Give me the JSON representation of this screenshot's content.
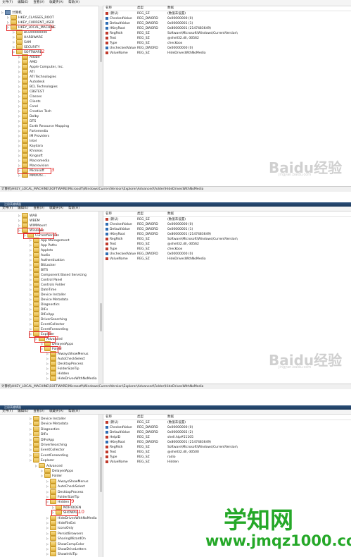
{
  "menu": [
    "文件(F)",
    "编辑(E)",
    "查看(V)",
    "收藏夹(A)",
    "帮助(H)"
  ],
  "window_title": "注册表编辑器",
  "list_headers": {
    "name": "名称",
    "type": "类型",
    "data": "数据"
  },
  "panel1": {
    "tree": [
      "计算机",
      "HKEY_CLASSES_ROOT",
      "HKEY_CURRENT_USER",
      "HKEY_LOCAL_MACHINE",
      "BCD00000000",
      "HARDWARE",
      "SAM",
      "SECURITY",
      "SOFTWARE",
      "Adobe",
      "AMD",
      "Apple Computer, Inc.",
      "ATI",
      "ATI Technologies",
      "Autodesk",
      "BCL Technologies",
      "CBSTEST",
      "Classes",
      "Clients",
      "Corel",
      "Creative Tech",
      "Dolby",
      "DTS",
      "Earth Resource Mapping",
      "Fortemedia",
      "IM Providers",
      "Intel",
      "Kaydara",
      "Khronos",
      "Kingsoft",
      "Macromedia",
      "Macrovision",
      "Microsoft",
      "MMXUtx..."
    ],
    "markers": [
      "1",
      "2",
      "3"
    ],
    "values": [
      {
        "name": "(默认)",
        "type": "REG_SZ",
        "data": "(数值未设置)",
        "icon": "sz"
      },
      {
        "name": "CheckedValue",
        "type": "REG_DWORD",
        "data": "0x00000000 (0)",
        "icon": "dw"
      },
      {
        "name": "DefaultValue",
        "type": "REG_DWORD",
        "data": "0x00000001 (1)",
        "icon": "dw"
      },
      {
        "name": "HKeyRoot",
        "type": "REG_DWORD",
        "data": "0x80000001 (2147483649)",
        "icon": "dw"
      },
      {
        "name": "RegPath",
        "type": "REG_SZ",
        "data": "Software\\Microsoft\\Windows\\CurrentVersion\\",
        "icon": "sz"
      },
      {
        "name": "Text",
        "type": "REG_SZ",
        "data": "@shell32.dll,-30562",
        "icon": "sz"
      },
      {
        "name": "Type",
        "type": "REG_SZ",
        "data": "checkbox",
        "icon": "sz"
      },
      {
        "name": "UncheckedValue",
        "type": "REG_DWORD",
        "data": "0x00000000 (0)",
        "icon": "dw"
      },
      {
        "name": "ValueName",
        "type": "REG_SZ",
        "data": "HideDrivesWithNoMedia",
        "icon": "sz"
      }
    ],
    "status": "计算机\\HKEY_LOCAL_MACHINE\\SOFTWARE\\Microsoft\\Windows\\CurrentVersion\\Explorer\\Advanced\\Folder\\HideDrivesWithNoMedia"
  },
  "panel2": {
    "tree": [
      "WAB",
      "WBEM",
      "WIMMount",
      "Windows",
      "CurrentVersion",
      "App Management",
      "App Paths",
      "Applets",
      "Audio",
      "Authentication",
      "BitLocker",
      "BITS",
      "Component Based Servicing",
      "Control Panel",
      "Controls Folder",
      "DateTime",
      "Device Installer",
      "Device Metadata",
      "Diagnostics",
      "DIFx",
      "DIFxApp",
      "DriverSearching",
      "EventCollector",
      "EventForwarding",
      "Explorer",
      "Advanced",
      "DelayedApps",
      "Folder",
      "AlwaysShowMenus",
      "AutoCheckSelect",
      "DesktopProcess",
      "FolderSizeTip",
      "Hidden",
      "HideDrivesWithNoMedia"
    ],
    "markers": [
      "4",
      "5",
      "6",
      "7",
      "8"
    ],
    "values": [
      {
        "name": "(默认)",
        "type": "REG_SZ",
        "data": "(数值未设置)",
        "icon": "sz"
      },
      {
        "name": "CheckedValue",
        "type": "REG_DWORD",
        "data": "0x00000000 (0)",
        "icon": "dw"
      },
      {
        "name": "DefaultValue",
        "type": "REG_DWORD",
        "data": "0x00000001 (1)",
        "icon": "dw"
      },
      {
        "name": "HKeyRoot",
        "type": "REG_DWORD",
        "data": "0x80000001 (2147483649)",
        "icon": "dw"
      },
      {
        "name": "RegPath",
        "type": "REG_SZ",
        "data": "Software\\Microsoft\\Windows\\CurrentVersion\\",
        "icon": "sz"
      },
      {
        "name": "Text",
        "type": "REG_SZ",
        "data": "@shell32.dll,-30562",
        "icon": "sz"
      },
      {
        "name": "Type",
        "type": "REG_SZ",
        "data": "checkbox",
        "icon": "sz"
      },
      {
        "name": "UncheckedValue",
        "type": "REG_DWORD",
        "data": "0x00000000 (0)",
        "icon": "dw"
      },
      {
        "name": "ValueName",
        "type": "REG_SZ",
        "data": "HideDrivesWithNoMedia",
        "icon": "sz"
      }
    ],
    "status": "计算机\\HKEY_LOCAL_MACHINE\\SOFTWARE\\Microsoft\\Windows\\CurrentVersion\\Explorer\\Advanced\\Folder\\HideDrivesWithNoMedia"
  },
  "panel3": {
    "tree": [
      "Device Installer",
      "Device Metadata",
      "Diagnostics",
      "DIFx",
      "DIFxApp",
      "DriverSearching",
      "EventCollector",
      "EventForwarding",
      "Explorer",
      "Advanced",
      "DelayedApps",
      "Folder",
      "AlwaysShowMenus",
      "AutoCheckSelect",
      "DesktopProcess",
      "FolderSizeTip",
      "Hidden",
      "NOHIDDEN",
      "SHOWALL",
      "HideDrivesWithNoMedia",
      "HideFileExt",
      "IconsOnly",
      "PersistBrowsers",
      "SharingWizardOn",
      "ShowCompColor",
      "ShowDriveLetters",
      "ShowInfoTip"
    ],
    "markers": [
      "9",
      "10"
    ],
    "values": [
      {
        "name": "(默认)",
        "type": "REG_SZ",
        "data": "(数值未设置)",
        "icon": "sz"
      },
      {
        "name": "CheckedValue",
        "type": "REG_DWORD",
        "data": "0x00000000 (0)",
        "icon": "dw"
      },
      {
        "name": "DefaultValue",
        "type": "REG_DWORD",
        "data": "0x00000002 (2)",
        "icon": "dw"
      },
      {
        "name": "HelpID",
        "type": "REG_SZ",
        "data": "shell.hlp#51105",
        "icon": "sz"
      },
      {
        "name": "HKeyRoot",
        "type": "REG_DWORD",
        "data": "0x80000001 (2147483649)",
        "icon": "dw"
      },
      {
        "name": "RegPath",
        "type": "REG_SZ",
        "data": "Software\\Microsoft\\Windows\\CurrentVersion\\",
        "icon": "sz"
      },
      {
        "name": "Text",
        "type": "REG_SZ",
        "data": "@shell32.dll,-30500",
        "icon": "sz"
      },
      {
        "name": "Type",
        "type": "REG_SZ",
        "data": "radio",
        "icon": "sz"
      },
      {
        "name": "ValueName",
        "type": "REG_SZ",
        "data": "Hidden",
        "icon": "sz"
      }
    ]
  },
  "watermark": {
    "baidu": "Baidu经验",
    "sub": "jingyan.baidu.com",
    "site_cn": "学知网",
    "site_url": "www.jmqz1000.com"
  }
}
